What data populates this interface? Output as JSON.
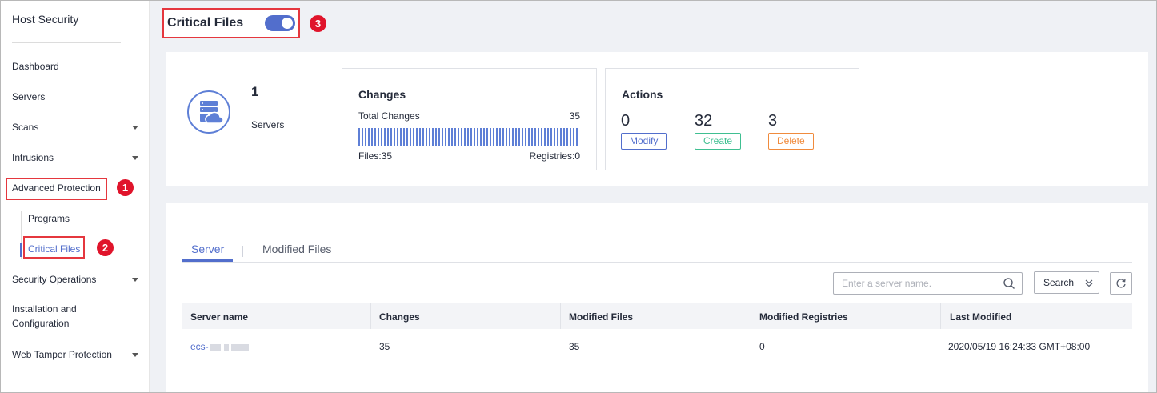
{
  "sidebar": {
    "title": "Host Security",
    "items": [
      {
        "label": "Dashboard"
      },
      {
        "label": "Servers"
      },
      {
        "label": "Scans"
      },
      {
        "label": "Intrusions"
      },
      {
        "label": "Advanced Protection"
      },
      {
        "label": "Security Operations"
      },
      {
        "label": "Installation and Configuration"
      },
      {
        "label": "Web Tamper Protection"
      }
    ],
    "sub_items": [
      {
        "label": "Programs"
      },
      {
        "label": "Critical Files"
      }
    ]
  },
  "callouts": [
    "1",
    "2",
    "3"
  ],
  "page": {
    "title": "Critical Files",
    "toggle_on": true
  },
  "summary": {
    "servers_count": "1",
    "servers_label": "Servers",
    "changes": {
      "title": "Changes",
      "total_label": "Total Changes",
      "total_value": "35",
      "files_label": "Files:35",
      "registries_label": "Registries:0"
    },
    "actions": {
      "title": "Actions",
      "modify_count": "0",
      "create_count": "32",
      "delete_count": "3",
      "modify_label": "Modify",
      "create_label": "Create",
      "delete_label": "Delete"
    }
  },
  "tabs": [
    {
      "label": "Server",
      "active": true
    },
    {
      "label": "Modified Files",
      "active": false
    }
  ],
  "search": {
    "placeholder": "Enter a server name.",
    "button_label": "Search"
  },
  "table": {
    "columns": [
      "Server name",
      "Changes",
      "Modified Files",
      "Modified Registries",
      "Last Modified"
    ],
    "rows": [
      {
        "server_name": "ecs-",
        "changes": "35",
        "modified_files": "35",
        "modified_registries": "0",
        "last_modified": "2020/05/19 16:24:33 GMT+08:00"
      }
    ]
  },
  "colors": {
    "accent": "#526ecc",
    "highlight": "#e5373e",
    "create": "#3fbf91",
    "delete": "#f08b3d"
  }
}
